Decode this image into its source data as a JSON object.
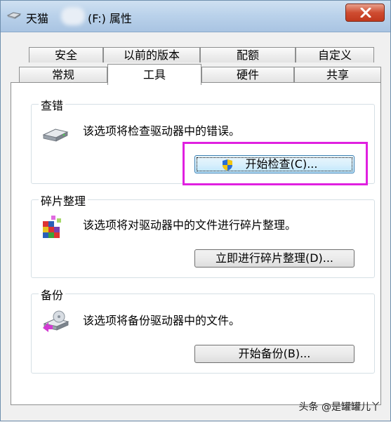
{
  "window": {
    "title_prefix": "天猫",
    "title_suffix": "(F:) 属性",
    "close_icon": "close-icon"
  },
  "tabs": {
    "row_back": [
      "安全",
      "以前的版本",
      "配额",
      "自定义"
    ],
    "row_front": [
      "常规",
      "工具",
      "硬件",
      "共享"
    ],
    "active": "工具"
  },
  "groups": {
    "error_check": {
      "label": "查错",
      "description": "该选项将检查驱动器中的错误。",
      "button_label": "开始检查(C)...",
      "icon": "drive-icon"
    },
    "defrag": {
      "label": "碎片整理",
      "description": "该选项将对驱动器中的文件进行碎片整理。",
      "button_label": "立即进行碎片整理(D)...",
      "icon": "defrag-icon"
    },
    "backup": {
      "label": "备份",
      "description": "该选项将备份驱动器中的文件。",
      "button_label": "开始备份(B)...",
      "icon": "backup-icon"
    }
  },
  "watermark": "头条 @是罐罐儿丫",
  "colors": {
    "highlight": "#e020e0",
    "close_button": "#cf4c31"
  }
}
